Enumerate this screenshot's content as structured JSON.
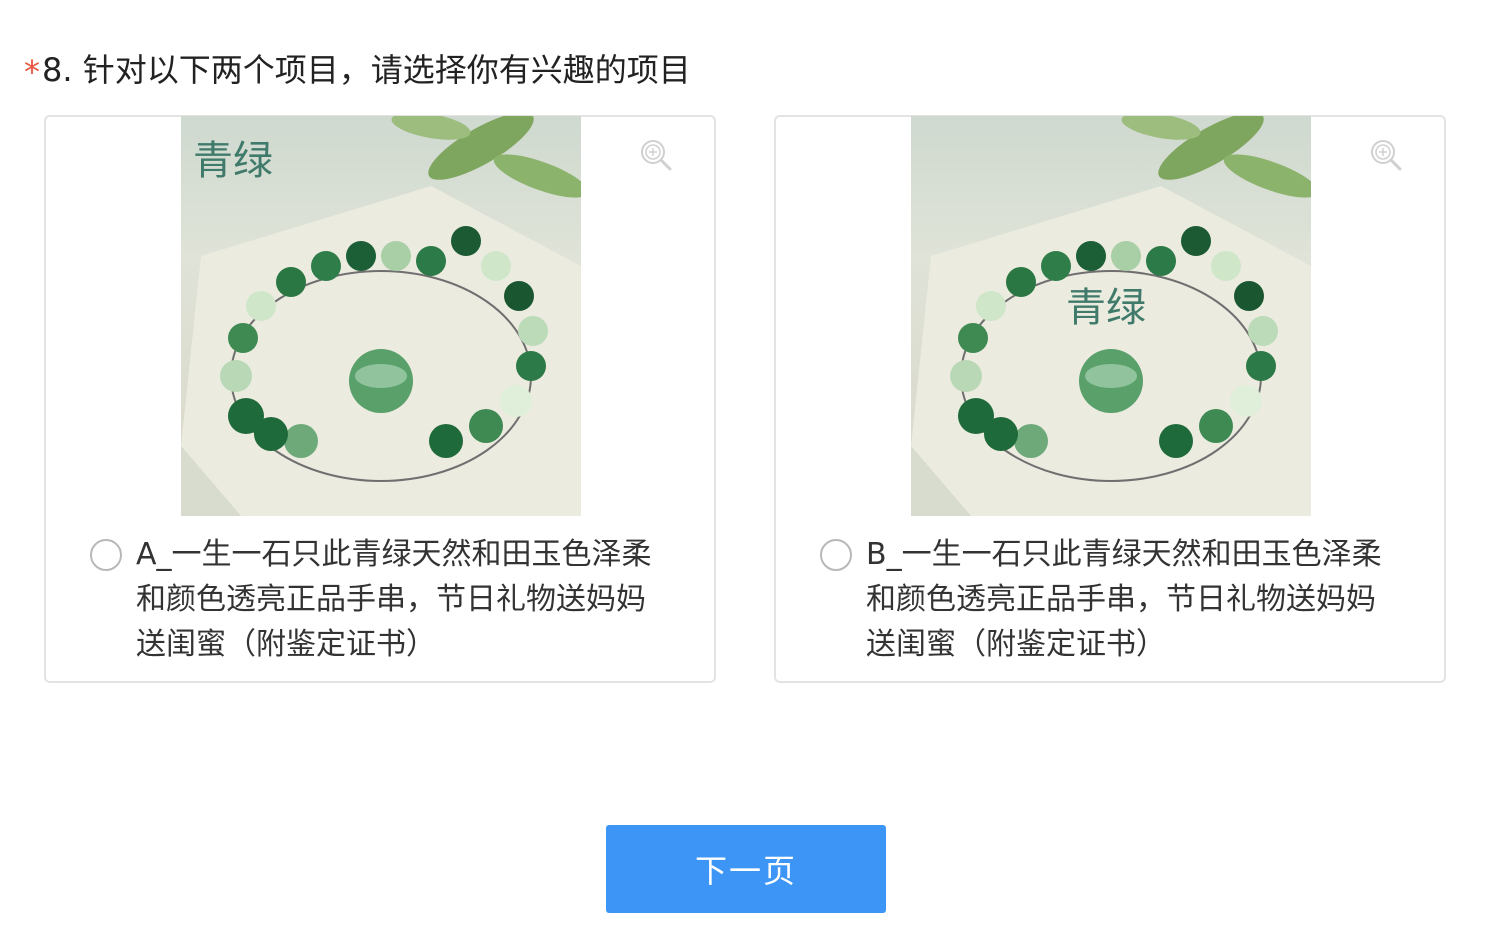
{
  "question": {
    "required_mark": "*",
    "title": "8. 针对以下两个项目，请选择你有兴趣的项目"
  },
  "options": [
    {
      "image_icon": "jade-bracelet-image",
      "watermark_text": "青绿",
      "zoom_icon": "zoom-in-icon",
      "selected": false,
      "label": "A_一生一石只此青绿天然和田玉色泽柔和颜色透亮正品手串，节日礼物送妈妈送闺蜜（附鉴定证书）"
    },
    {
      "image_icon": "jade-bracelet-image",
      "watermark_text": "青绿",
      "zoom_icon": "zoom-in-icon",
      "selected": false,
      "label": "B_一生一石只此青绿天然和田玉色泽柔和颜色透亮正品手串，节日礼物送妈妈送闺蜜（附鉴定证书）"
    }
  ],
  "footer": {
    "next_label": "下一页"
  },
  "colors": {
    "required": "#e8553e",
    "button": "#3d96f5",
    "card_border": "#e3e3e3"
  }
}
